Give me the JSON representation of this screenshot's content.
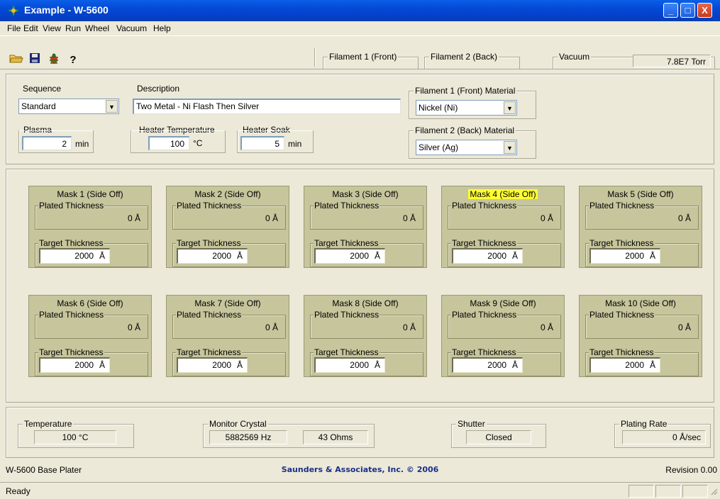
{
  "window": {
    "title": "Example - W-5600",
    "minimize": "_",
    "maximize": "□",
    "close": "X"
  },
  "menu": [
    "File",
    "Edit",
    "View",
    "Run",
    "Wheel",
    "Vacuum",
    "Help"
  ],
  "toolbar": {
    "icons": [
      "open-folder-icon",
      "save-icon",
      "bug-icon",
      "help-icon"
    ],
    "filament1_label": "Filament 1 (Front)",
    "filament2_label": "Filament 2 (Back)",
    "vacuum_label": "Vacuum",
    "vacuum_value": "7.8E7  Torr"
  },
  "settings": {
    "sequence_label": "Sequence",
    "sequence_value": "Standard",
    "description_label": "Description",
    "description_value": "Two Metal - Ni Flash Then Silver",
    "filament1_material_label": "Filament 1 (Front) Material",
    "filament1_material_value": "Nickel (Ni)",
    "filament2_material_label": "Filament 2 (Back) Material",
    "filament2_material_value": "Silver (Ag)",
    "plasma_label": "Plasma",
    "plasma_value": "2",
    "plasma_unit": "min",
    "heater_temp_label": "Heater Temperature",
    "heater_temp_value": "100",
    "heater_temp_unit": "°C",
    "heater_soak_label": "Heater Soak",
    "heater_soak_value": "5",
    "heater_soak_unit": "min"
  },
  "masks": [
    {
      "title": "Mask 1 (Side Off)",
      "plated_label": "Plated Thickness",
      "plated": "0 Å",
      "target_label": "Target Thickness",
      "target": "2000",
      "unit": "Å",
      "highlighted": false
    },
    {
      "title": "Mask 2 (Side Off)",
      "plated_label": "Plated Thickness",
      "plated": "0 Å",
      "target_label": "Target Thickness",
      "target": "2000",
      "unit": "Å",
      "highlighted": false
    },
    {
      "title": "Mask 3 (Side Off)",
      "plated_label": "Plated Thickness",
      "plated": "0 Å",
      "target_label": "Target Thickness",
      "target": "2000",
      "unit": "Å",
      "highlighted": false
    },
    {
      "title": "Mask 4 (Side Off)",
      "plated_label": "Plated Thickness",
      "plated": "0 Å",
      "target_label": "Target Thickness",
      "target": "2000",
      "unit": "Å",
      "highlighted": true
    },
    {
      "title": "Mask 5 (Side Off)",
      "plated_label": "Plated Thickness",
      "plated": "0 Å",
      "target_label": "Target Thickness",
      "target": "2000",
      "unit": "Å",
      "highlighted": false
    },
    {
      "title": "Mask 6 (Side Off)",
      "plated_label": "Plated Thickness",
      "plated": "0 Å",
      "target_label": "Target Thickness",
      "target": "2000",
      "unit": "Å",
      "highlighted": false
    },
    {
      "title": "Mask 7 (Side Off)",
      "plated_label": "Plated Thickness",
      "plated": "0 Å",
      "target_label": "Target Thickness",
      "target": "2000",
      "unit": "Å",
      "highlighted": false
    },
    {
      "title": "Mask 8 (Side Off)",
      "plated_label": "Plated Thickness",
      "plated": "0 Å",
      "target_label": "Target Thickness",
      "target": "2000",
      "unit": "Å",
      "highlighted": false
    },
    {
      "title": "Mask 9 (Side Off)",
      "plated_label": "Plated Thickness",
      "plated": "0 Å",
      "target_label": "Target Thickness",
      "target": "2000",
      "unit": "Å",
      "highlighted": false
    },
    {
      "title": "Mask 10 (Side Off)",
      "plated_label": "Plated Thickness",
      "plated": "0 Å",
      "target_label": "Target Thickness",
      "target": "2000",
      "unit": "Å",
      "highlighted": false
    }
  ],
  "status": {
    "temperature_label": "Temperature",
    "temperature_value": "100  °C",
    "monitor_label": "Monitor Crystal",
    "monitor_hz": "5882569  Hz",
    "monitor_ohms": "43  Ohms",
    "shutter_label": "Shutter",
    "shutter_value": "Closed",
    "plating_rate_label": "Plating Rate",
    "plating_rate_value": "0  Å/sec"
  },
  "footer": {
    "product": "W-5600 Base Plater",
    "copyright": "Saunders & Associates, Inc.  © 2006",
    "revision": "Revision 0.00",
    "status_text": "Ready"
  },
  "colors": {
    "highlight": "#ffff33",
    "mask_bg": "#c6c59c",
    "copyright": "#1a2f8a"
  }
}
